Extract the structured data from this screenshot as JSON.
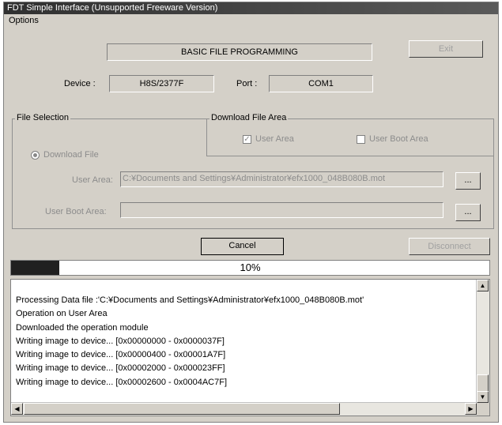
{
  "window": {
    "title": "FDT Simple Interface   (Unsupported Freeware Version)"
  },
  "menu": {
    "options": "Options"
  },
  "header": {
    "mode": "BASIC FILE PROGRAMMING",
    "exit_label": "Exit",
    "device_label": "Device :",
    "device_value": "H8S/2377F",
    "port_label": "Port :",
    "port_value": "COM1"
  },
  "file_selection": {
    "legend": "File Selection",
    "download_file_label": "Download File",
    "download_file_selected": true,
    "user_area_label": "User Area:",
    "user_area_path": "C:¥Documents and Settings¥Administrator¥efx1000_048B080B.mot",
    "user_boot_area_label": "User Boot Area:",
    "user_boot_area_path": "",
    "browse_label": "..."
  },
  "download_file_area": {
    "legend": "Download File Area",
    "user_area_label": "User Area",
    "user_area_checked": true,
    "user_boot_area_label": "User Boot Area",
    "user_boot_area_checked": false,
    "check_mark": "✓"
  },
  "actions": {
    "cancel_label": "Cancel",
    "disconnect_label": "Disconnect"
  },
  "progress": {
    "percent_text": "10%",
    "value": 0.1
  },
  "log": {
    "lines": [
      "Processing Data file :'C:¥Documents and Settings¥Administrator¥efx1000_048B080B.mot'",
      "Operation on User Area",
      "Downloaded the operation module",
      "Writing image to device... [0x00000000 - 0x0000037F]",
      "Writing image to device... [0x00000400 - 0x00001A7F]",
      "Writing image to device... [0x00002000 - 0x000023FF]",
      "Writing image to device... [0x00002600 - 0x0004AC7F]"
    ],
    "scroll_up": "▲",
    "scroll_down": "▼",
    "scroll_left": "◀",
    "scroll_right": "▶"
  }
}
